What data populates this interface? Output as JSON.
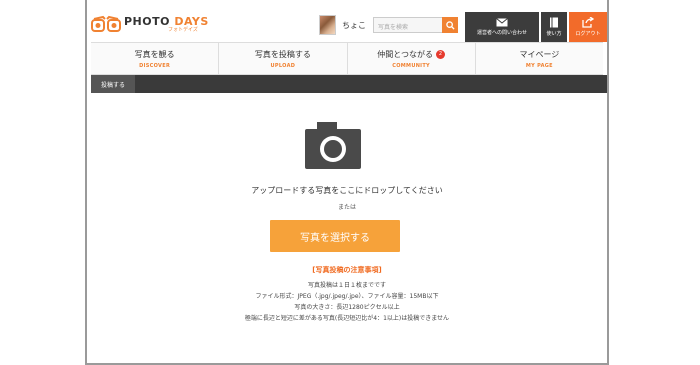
{
  "header": {
    "logo_text_a": "PHOTO",
    "logo_text_b": "DAYS",
    "logo_sub": "フォトデイズ",
    "username": "ちょこ",
    "search_placeholder": "写真を検索",
    "contact_label": "運営者への問い合わせ",
    "howto_label": "使い方",
    "logout_label": "ログアウト"
  },
  "nav": {
    "items": [
      {
        "jp": "写真を観る",
        "en": "DISCOVER"
      },
      {
        "jp": "写真を投稿する",
        "en": "UPLOAD"
      },
      {
        "jp": "仲間とつながる",
        "en": "COMMUNITY",
        "badge": "2"
      },
      {
        "jp": "マイページ",
        "en": "MY PAGE"
      }
    ]
  },
  "subbar": {
    "tab": "投稿する"
  },
  "main": {
    "drop_text": "アップロードする写真をここにドロップしてください",
    "or_text": "または",
    "select_button": "写真を選択する",
    "notice_title": "[写真投稿の注意事項]",
    "notices": [
      "写真投稿は１日１枚までです",
      "ファイル形式：JPEG（.jpg/.jpeg/.jpe）、ファイル容量：15MB以下",
      "写真の大きさ：長辺1280ピクセル以上",
      "極端に長辺と短辺に差がある写真(長辺短辺比が4：1以上)は投稿できません"
    ]
  },
  "colors": {
    "accent": "#f08232",
    "button": "#f6a23a",
    "dark": "#3c3c3c",
    "logout": "#f26b2a"
  }
}
